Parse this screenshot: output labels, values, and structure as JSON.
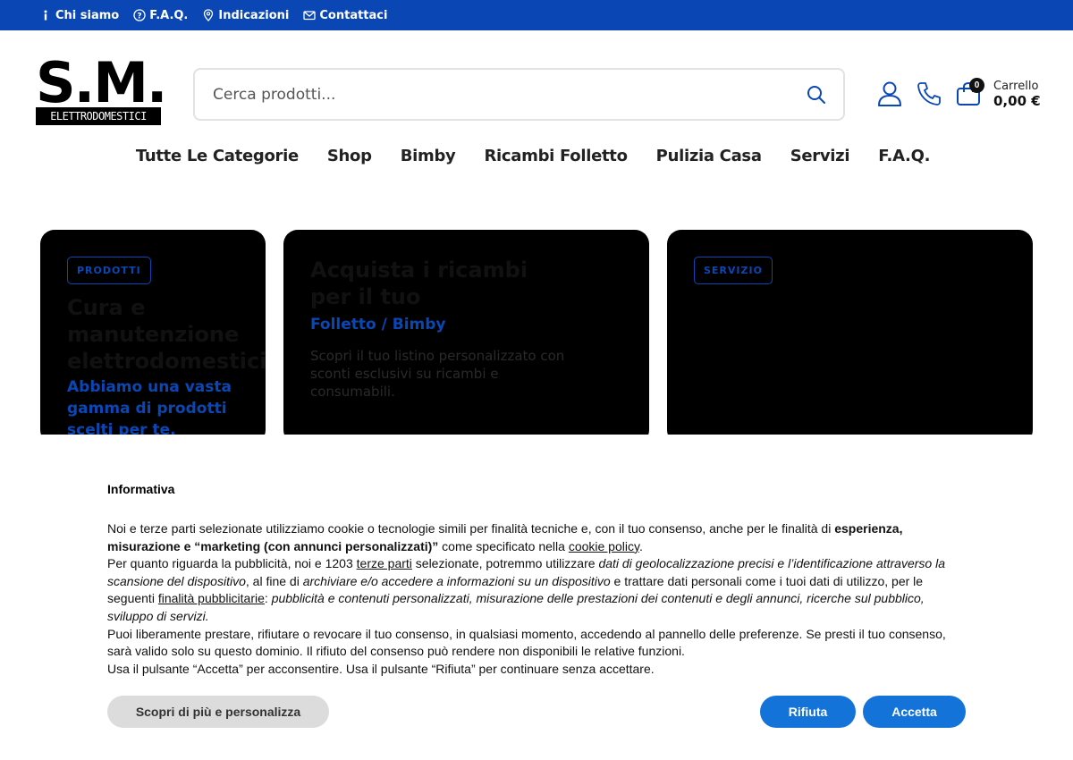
{
  "topbar": {
    "links": [
      {
        "label": "Chi siamo",
        "icon": "info-icon"
      },
      {
        "label": "F.A.Q.",
        "icon": "question-circle-icon"
      },
      {
        "label": "Indicazioni",
        "icon": "map-pin-icon"
      },
      {
        "label": "Contattaci",
        "icon": "mail-icon"
      }
    ],
    "color": "#0a47b5"
  },
  "logo": {
    "big": "S.M.",
    "band": "ELETTRODOMESTICI"
  },
  "search": {
    "placeholder": "Cerca prodotti..."
  },
  "cart": {
    "count": "0",
    "label": "Carrello",
    "total": "0,00 €"
  },
  "nav": [
    "Tutte Le Categorie",
    "Shop",
    "Bimby",
    "Ricambi Folletto",
    "Pulizia Casa",
    "Servizi",
    "F.A.Q."
  ],
  "cards": [
    {
      "tag": "PRODOTTI",
      "title": "Cura e manutenzione elettrodomestici",
      "subtitle": "Abbiamo una vasta gamma di prodotti scelti per te."
    },
    {
      "title": "Acquista i ricambi per il tuo",
      "subtitle": "Folletto / Bimby",
      "text": "Scopri il tuo listino personalizzato con sconti esclusivi su ricambi e consumabili."
    },
    {
      "tag": "SERVIZIO"
    }
  ],
  "cookie": {
    "title": "Informativa",
    "p1a": "Noi e terze parti selezionate utilizziamo cookie o tecnologie simili per finalità tecniche e, con il tuo consenso, anche per le finalità di ",
    "p1b": "esperienza, misurazione e “marketing (con annunci personalizzati)”",
    "p1c": " come specificato nella ",
    "p1link": "cookie policy",
    "p1d": ".",
    "p2a": "Per quanto riguarda la pubblicità, noi e 1203 ",
    "p2link": "terze parti",
    "p2b": " selezionate, potremmo utilizzare ",
    "p2c": "dati di geolocalizzazione precisi e l’identificazione attraverso la scansione del dispositivo",
    "p2d": ", al fine di ",
    "p2e": "archiviare e/o accedere a informazioni su un dispositivo",
    "p2f": " e trattare dati personali come i tuoi dati di utilizzo, per le seguenti ",
    "p2link2": "finalità pubblicitarie",
    "p2g": ": ",
    "p2h": "pubblicità e contenuti personalizzati, misurazione delle prestazioni dei contenuti e degli annunci, ricerche sul pubblico, sviluppo di servizi.",
    "p3": "Puoi liberamente prestare, rifiutare o revocare il tuo consenso, in qualsiasi momento, accedendo al pannello delle preferenze. Se presti il tuo consenso, sarà valido solo su questo dominio. Il rifiuto del consenso può rendere non disponibili le relative funzioni.",
    "p4": "Usa il pulsante “Accetta” per acconsentire. Usa il pulsante “Rifiuta” per continuare senza accettare.",
    "btn_more": "Scopri di più e personalizza",
    "btn_reject": "Rifiuta",
    "btn_accept": "Accetta",
    "accent": "#1373d8"
  }
}
